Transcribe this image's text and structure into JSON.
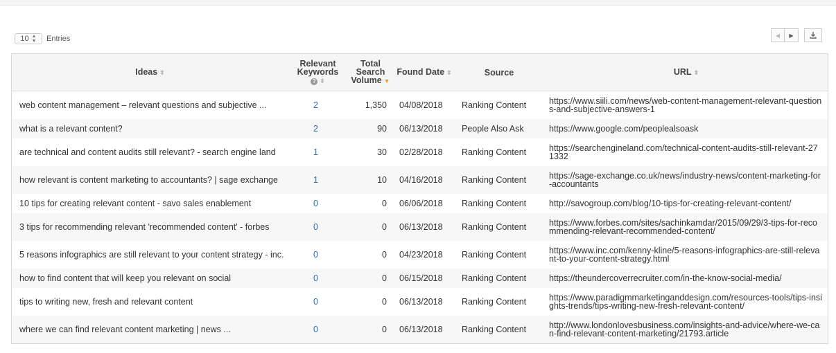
{
  "entries": {
    "value": "10",
    "label": "Entries"
  },
  "pager": {
    "prev_icon": "triangle-left-icon",
    "next_icon": "triangle-right-icon",
    "download_icon": "download-icon"
  },
  "table": {
    "headers": {
      "ideas": "Ideas",
      "relevant_keywords": "Relevant Keywords",
      "total_search_volume": "Total Search Volume",
      "found_date": "Found Date",
      "source": "Source",
      "url": "URL"
    },
    "rows": [
      {
        "idea": "web content management – relevant questions and subjective ...",
        "keywords": "2",
        "volume": "1,350",
        "date": "04/08/2018",
        "source": "Ranking Content",
        "url": "https://www.siili.com/news/web-content-management-relevant-questions-and-subjective-answers-1"
      },
      {
        "idea": "what is a relevant content?",
        "keywords": "2",
        "volume": "90",
        "date": "06/13/2018",
        "source": "People Also Ask",
        "url": "https://www.google.com/peoplealsoask"
      },
      {
        "idea": "are technical and content audits still relevant? - search engine land",
        "keywords": "1",
        "volume": "30",
        "date": "02/28/2018",
        "source": "Ranking Content",
        "url": "https://searchengineland.com/technical-content-audits-still-relevant-271332"
      },
      {
        "idea": "how relevant is content marketing to accountants? | sage exchange",
        "keywords": "1",
        "volume": "10",
        "date": "04/16/2018",
        "source": "Ranking Content",
        "url": "https://sage-exchange.co.uk/news/industry-news/content-marketing-for-accountants"
      },
      {
        "idea": "10 tips for creating relevant content - savo sales enablement",
        "keywords": "0",
        "volume": "0",
        "date": "06/06/2018",
        "source": "Ranking Content",
        "url": "http://savogroup.com/blog/10-tips-for-creating-relevant-content/"
      },
      {
        "idea": "3 tips for recommending relevant 'recommended content' - forbes",
        "keywords": "0",
        "volume": "0",
        "date": "06/13/2018",
        "source": "Ranking Content",
        "url": "https://www.forbes.com/sites/sachinkamdar/2015/09/29/3-tips-for-recommending-relevant-recommended-content/"
      },
      {
        "idea": "5 reasons infographics are still relevant to your content strategy - inc.",
        "keywords": "0",
        "volume": "0",
        "date": "04/23/2018",
        "source": "Ranking Content",
        "url": "https://www.inc.com/kenny-kline/5-reasons-infographics-are-still-relevant-to-your-content-strategy.html"
      },
      {
        "idea": "how to find content that will keep you relevant on social",
        "keywords": "0",
        "volume": "0",
        "date": "06/15/2018",
        "source": "Ranking Content",
        "url": "https://theundercoverrecruiter.com/in-the-know-social-media/"
      },
      {
        "idea": "tips to writing new, fresh and relevant content",
        "keywords": "0",
        "volume": "0",
        "date": "06/13/2018",
        "source": "Ranking Content",
        "url": "https://www.paradigmmarketinganddesign.com/resources-tools/tips-insights-trends/tips-writing-new-fresh-relevant-content/"
      },
      {
        "idea": "where we can find relevant content marketing | news ...",
        "keywords": "0",
        "volume": "0",
        "date": "06/13/2018",
        "source": "Ranking Content",
        "url": "http://www.londonlovesbusiness.com/insights-and-advice/where-we-can-find-relevant-content-marketing/21793.article"
      }
    ]
  }
}
